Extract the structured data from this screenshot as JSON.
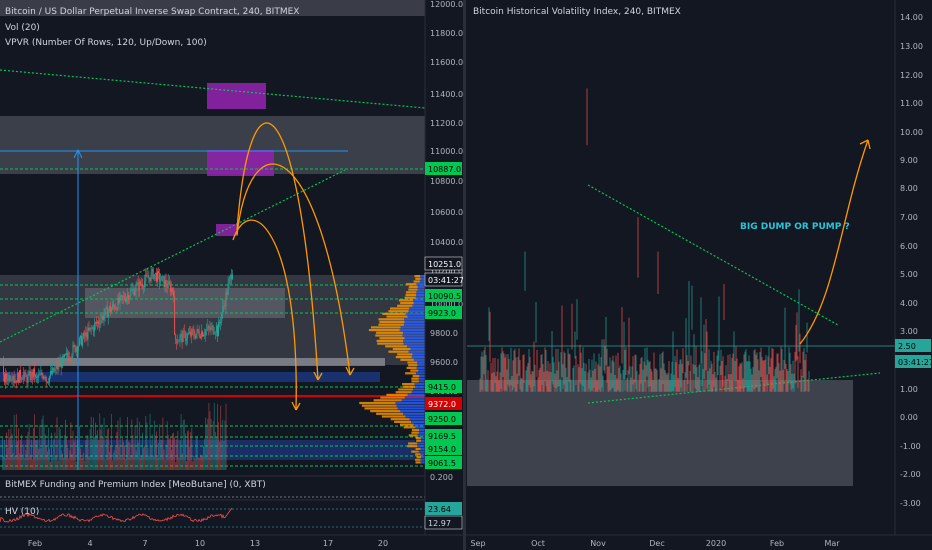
{
  "left_chart": {
    "title": "Bitcoin / US Dollar Perpetual Inverse Swap Contract, 240, BITMEX",
    "indicator1": "Vol (20)",
    "indicator2": "VPVR (Number Of Rows, 120, Up/Down, 100)",
    "indicator3": "BitMEX Funding and Premium Index [MeoButane] (0, XBT)",
    "indicator4": "HV (10)",
    "y_ticks": [
      "12000.0",
      "11800.0",
      "11600.0",
      "11400.0",
      "11200.0",
      "11000.0",
      "10800.0",
      "10600.0",
      "10400.0",
      "10200.0",
      "10000.0",
      "9800.0",
      "9600.0",
      "9400.0",
      "9200.0",
      "0.200"
    ],
    "x_ticks": [
      "Feb",
      "4",
      "7",
      "10",
      "13",
      "17",
      "20"
    ],
    "price_labels": [
      {
        "text": "10887.0",
        "bg": "#00c853",
        "fg": "#000000"
      },
      {
        "text": "10251.0",
        "bg": "#131722",
        "fg": "#ffffff"
      },
      {
        "text": "03:41:27",
        "bg": "#131722",
        "fg": "#ffffff"
      },
      {
        "text": "10090.5",
        "bg": "#00c853",
        "fg": "#000000"
      },
      {
        "text": "9923.0",
        "bg": "#00c853",
        "fg": "#000000"
      },
      {
        "text": "9415.0",
        "bg": "#00c853",
        "fg": "#000000"
      },
      {
        "text": "9372.0",
        "bg": "#d50000",
        "fg": "#ffffff"
      },
      {
        "text": "9250.0",
        "bg": "#00c853",
        "fg": "#000000"
      },
      {
        "text": "9169.5",
        "bg": "#00c853",
        "fg": "#000000"
      },
      {
        "text": "9154.0",
        "bg": "#00c853",
        "fg": "#000000"
      },
      {
        "text": "9061.5",
        "bg": "#00c853",
        "fg": "#000000"
      },
      {
        "text": "23.64",
        "bg": "#26a69a",
        "fg": "#000000"
      },
      {
        "text": "12.97",
        "bg": "#131722",
        "fg": "#d1d4dc"
      }
    ]
  },
  "right_chart": {
    "title": "Bitcoin Historical Volatility Index, 240, BITMEX",
    "annotation": "BIG DUMP OR PUMP  ?",
    "y_ticks": [
      "14.00",
      "13.00",
      "12.00",
      "11.00",
      "10.00",
      "9.00",
      "8.00",
      "7.00",
      "6.00",
      "5.00",
      "4.00",
      "3.00",
      "2.00",
      "1.00",
      "0.00",
      "-1.00",
      "-2.00",
      "-3.00"
    ],
    "x_ticks": [
      "Sep",
      "Oct",
      "Nov",
      "Dec",
      "2020",
      "Feb",
      "Mar"
    ],
    "price_labels": [
      {
        "text": "2.50",
        "bg": "#26a69a",
        "fg": "#000000"
      },
      {
        "text": "03:41:27",
        "bg": "#26a69a",
        "fg": "#000000"
      }
    ]
  },
  "chart_data": [
    {
      "type": "line",
      "title": "Bitcoin / US Dollar Perpetual Inverse Swap Contract, 240, BITMEX",
      "ylim": [
        9000,
        12000
      ],
      "key_levels": [
        10887.0,
        10251.0,
        10090.5,
        9923.0,
        9415.0,
        9372.0,
        9250.0,
        9169.5,
        9154.0,
        9061.5
      ],
      "last_price": 10251.0
    },
    {
      "type": "line",
      "title": "Bitcoin Historical Volatility Index, 240, BITMEX",
      "ylim": [
        -3,
        14
      ],
      "last_value": 2.5,
      "peak_value": 11.5
    }
  ],
  "colors": {
    "background": "#131722",
    "green_level": "#00c853",
    "red_level": "#d50000",
    "purple_box": "#8e24aa",
    "orange_arrow": "#ff9800",
    "annotation": "#26c6da",
    "candle_up": "#26a69a",
    "candle_down": "#ef5350"
  }
}
